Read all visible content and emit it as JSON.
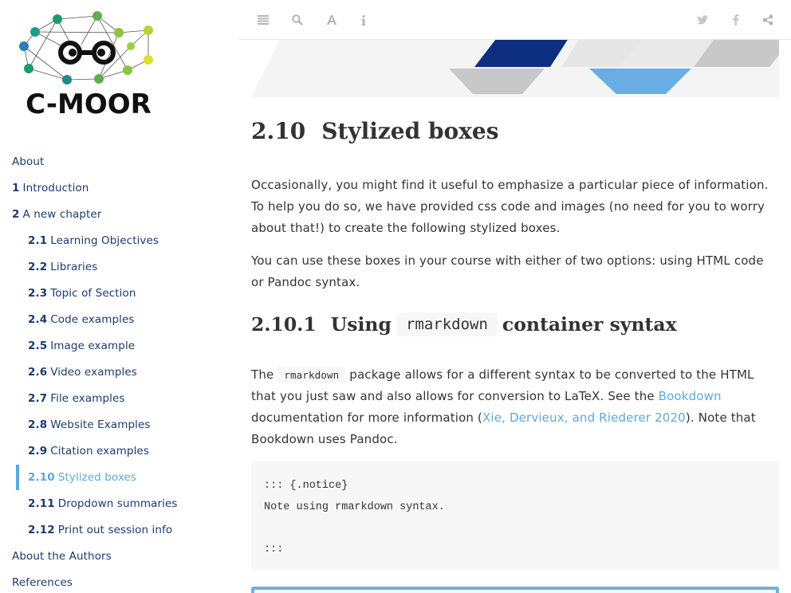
{
  "brand": {
    "logo_text": "C-MOOR"
  },
  "toolbar": {
    "icons": [
      "toc-toggle-icon",
      "search-icon",
      "font-settings-icon",
      "info-icon",
      "twitter-icon",
      "facebook-icon",
      "share-icon"
    ]
  },
  "sidebar": {
    "items": [
      {
        "num": "",
        "label": "About",
        "level": 1
      },
      {
        "num": "1",
        "label": "Introduction",
        "level": 1
      },
      {
        "num": "2",
        "label": "A new chapter",
        "level": 1
      },
      {
        "num": "2.1",
        "label": "Learning Objectives",
        "level": 2
      },
      {
        "num": "2.2",
        "label": "Libraries",
        "level": 2
      },
      {
        "num": "2.3",
        "label": "Topic of Section",
        "level": 2
      },
      {
        "num": "2.4",
        "label": "Code examples",
        "level": 2
      },
      {
        "num": "2.5",
        "label": "Image example",
        "level": 2
      },
      {
        "num": "2.6",
        "label": "Video examples",
        "level": 2
      },
      {
        "num": "2.7",
        "label": "File examples",
        "level": 2
      },
      {
        "num": "2.8",
        "label": "Website Examples",
        "level": 2
      },
      {
        "num": "2.9",
        "label": "Citation examples",
        "level": 2
      },
      {
        "num": "2.10",
        "label": "Stylized boxes",
        "level": 2,
        "active": true
      },
      {
        "num": "2.11",
        "label": "Dropdown summaries",
        "level": 2
      },
      {
        "num": "2.12",
        "label": "Print out session info",
        "level": 2
      },
      {
        "num": "",
        "label": "About the Authors",
        "level": 1
      },
      {
        "num": "",
        "label": "References",
        "level": 1
      }
    ]
  },
  "main": {
    "section": {
      "num": "2.10",
      "title": "Stylized boxes"
    },
    "para1": "Occasionally, you might find it useful to emphasize a particular piece of information. To help you do so, we have provided css code and images (no need for you to worry about that!) to create the following stylized boxes.",
    "para2": "You can use these boxes in your course with either of two options: using HTML code or Pandoc syntax.",
    "subsection": {
      "num": "2.10.1",
      "before": "Using",
      "code": "rmarkdown",
      "after": "container syntax"
    },
    "para3": {
      "t1": "The",
      "code": "rmarkdown",
      "t2": "package allows for a different syntax to be converted to the HTML that you just saw and also allows for conversion to LaTeX. See the",
      "link1": "Bookdown",
      "t3": "documentation for more information (",
      "link2": "Xie, Dervieux, and Riederer 2020",
      "t4": "). Note that Bookdown uses Pandoc."
    },
    "codeblock": "::: {.notice}\nNote using rmarkdown syntax.\n\n:::"
  },
  "colors": {
    "accent": "#5ea7dd",
    "navy": "#1b3b6f",
    "banner_dark": "#0d2f7e",
    "banner_light": "#6aade4",
    "notice_border": "#6fb0e2"
  }
}
